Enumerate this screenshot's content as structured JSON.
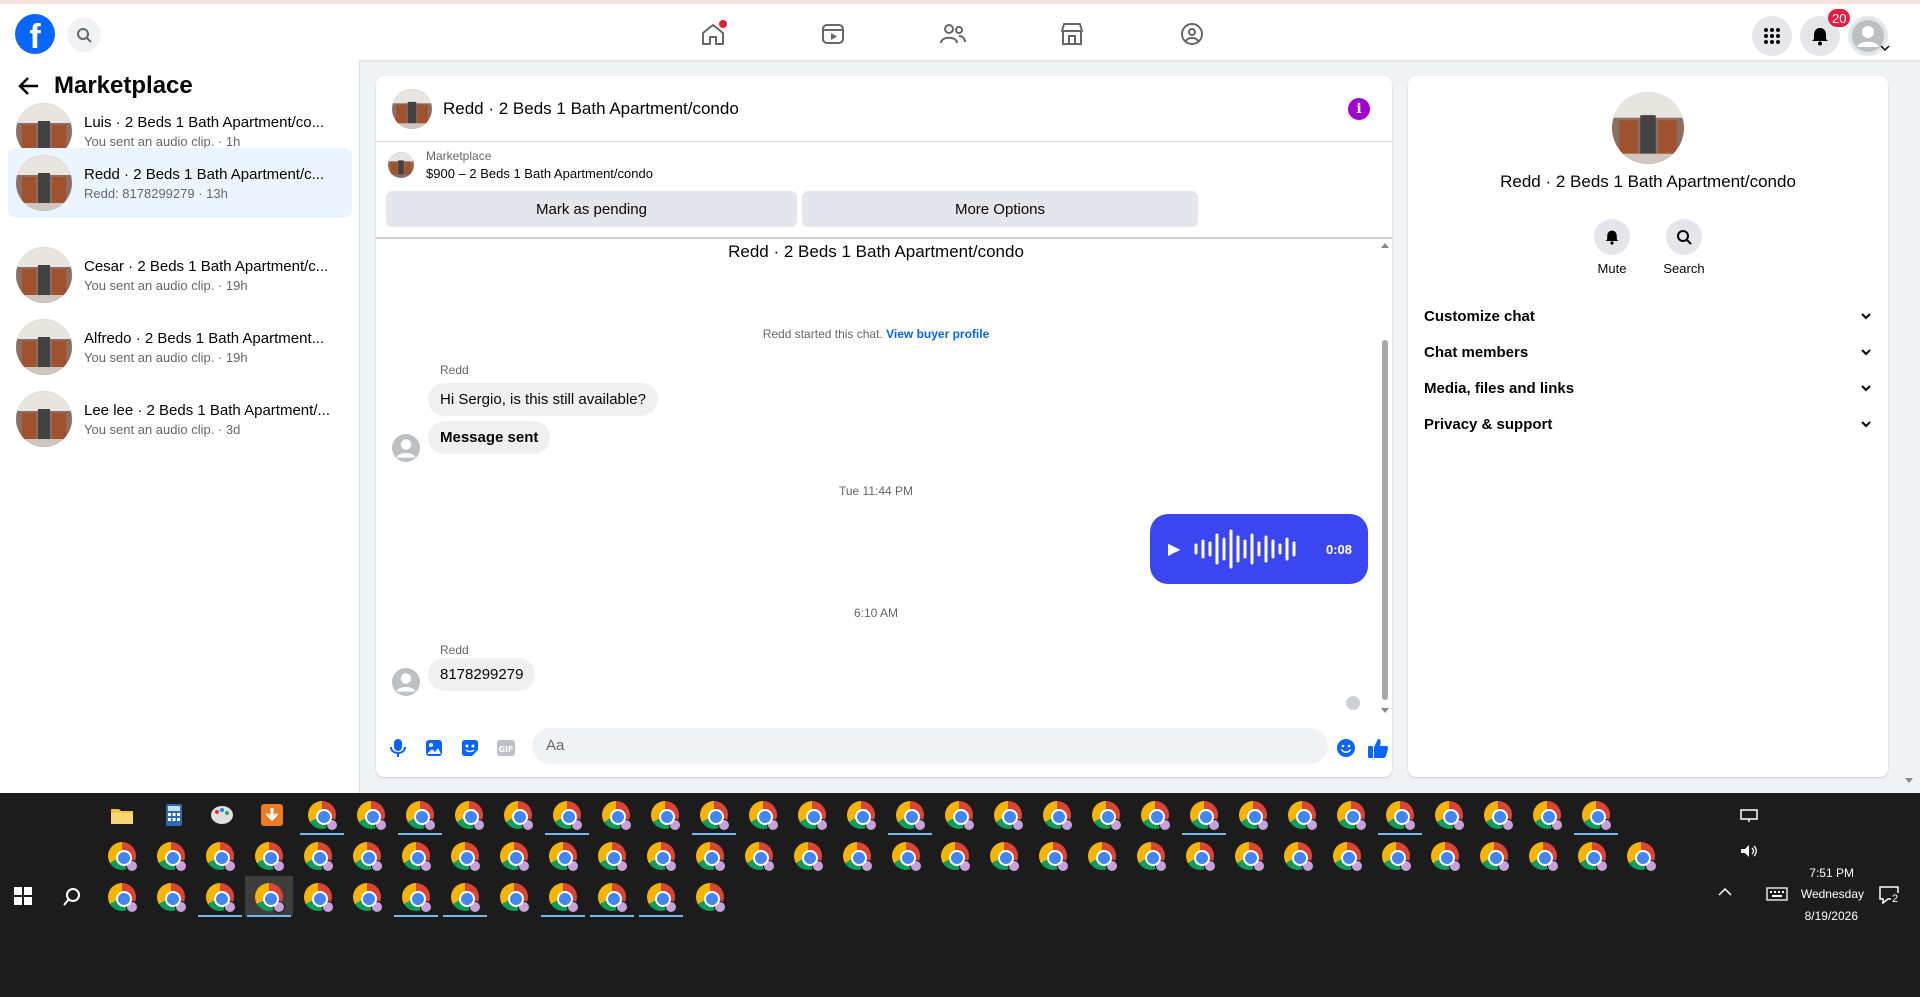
{
  "topbar": {
    "logo": "f",
    "notification_count": "20"
  },
  "sidebar": {
    "title": "Marketplace",
    "conversations": [
      {
        "title": "Luis · 2 Beds 1 Bath Apartment/co...",
        "subtitle": "You sent an audio clip. · 1h"
      },
      {
        "title": "Redd · 2 Beds 1 Bath Apartment/c...",
        "subtitle": "Redd: 8178299279 · 13h"
      },
      {
        "title": "Cesar · 2 Beds 1 Bath Apartment/c...",
        "subtitle": "You sent an audio clip. · 19h"
      },
      {
        "title": "Alfredo · 2 Beds 1 Bath Apartment...",
        "subtitle": "You sent an audio clip. · 19h"
      },
      {
        "title": "Lee lee · 2 Beds 1 Bath Apartment/...",
        "subtitle": "You sent an audio clip. · 3d"
      }
    ]
  },
  "chat": {
    "title": "Redd · 2 Beds 1 Bath Apartment/condo",
    "listing_source": "Marketplace",
    "listing_price": "$900 – 2 Beds 1 Bath Apartment/condo",
    "mark_pending": "Mark as pending",
    "more_options": "More Options",
    "heading": "Redd · 2 Beds 1 Bath Apartment/condo",
    "started_text": "Redd started this chat.",
    "view_profile": "View buyer profile",
    "messages": [
      {
        "sender": "Redd",
        "text": "Hi Sergio, is this still available?"
      },
      {
        "text": "Message sent"
      },
      {
        "timestamp": "Tue 11:44 PM"
      },
      {
        "audio_duration": "0:08"
      },
      {
        "timestamp": "6:10 AM"
      },
      {
        "sender": "Redd",
        "text": "8178299279"
      }
    ],
    "composer_placeholder": "Aa"
  },
  "right_panel": {
    "title": "Redd · 2 Beds 1 Bath Apartment/condo",
    "mute": "Mute",
    "search": "Search",
    "sections": [
      "Customize chat",
      "Chat members",
      "Media, files and links",
      "Privacy & support"
    ]
  },
  "taskbar": {
    "time": "7:51 PM",
    "day": "Wednesday",
    "date": "8/19/2026",
    "notification_count": "2"
  },
  "colors": {
    "brand": "#0866ff",
    "audio_bubble": "#3b45f0",
    "info": "#a100d1",
    "badge": "#e41e3f"
  }
}
